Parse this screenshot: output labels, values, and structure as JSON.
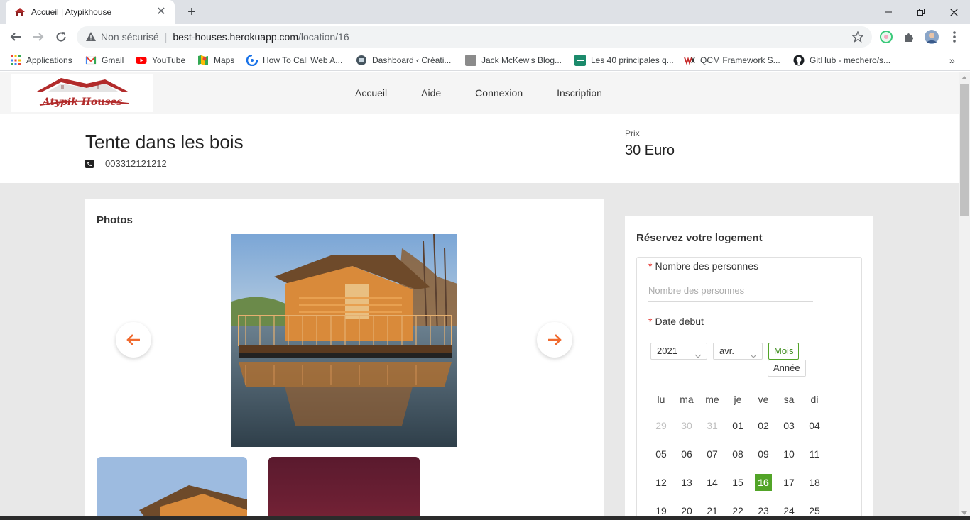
{
  "browser": {
    "tab_title": "Accueil | Atypikhouse",
    "new_tab": "+",
    "close_tab": "✕",
    "url_security": "Non sécurisé",
    "url_host": "best-houses.herokuapp.com",
    "url_path": "/location/16",
    "bookmarks": [
      {
        "label": "Applications",
        "icon": "apps-grid-icon"
      },
      {
        "label": "Gmail",
        "icon": "gmail-icon"
      },
      {
        "label": "YouTube",
        "icon": "youtube-icon"
      },
      {
        "label": "Maps",
        "icon": "maps-icon"
      },
      {
        "label": "How To Call Web A...",
        "icon": "web-api-icon"
      },
      {
        "label": "Dashboard ‹ Créati...",
        "icon": "dashboard-icon"
      },
      {
        "label": "Jack McKew's Blog...",
        "icon": "blog-icon"
      },
      {
        "label": "Les 40 principales q...",
        "icon": "list-icon"
      },
      {
        "label": "QCM Framework S...",
        "icon": "qcm-icon"
      },
      {
        "label": "GitHub - mechero/s...",
        "icon": "github-icon"
      }
    ],
    "more_bookmarks": "»"
  },
  "site": {
    "logo_text": "Atypik Houses",
    "nav": [
      "Accueil",
      "Aide",
      "Connexion",
      "Inscription"
    ]
  },
  "listing": {
    "title": "Tente dans les bois",
    "phone": "003312121212",
    "price_label": "Prix",
    "price_value": "30 Euro"
  },
  "photos": {
    "title": "Photos"
  },
  "booking": {
    "title": "Réservez votre logement",
    "required_mark": "*",
    "people_label": "Nombre des personnes",
    "people_placeholder": "Nombre des personnes",
    "date_label": "Date debut",
    "year": "2021",
    "month": "avr.",
    "mode_month": "Mois",
    "mode_year": "Année",
    "weekdays": [
      "lu",
      "ma",
      "me",
      "je",
      "ve",
      "sa",
      "di"
    ],
    "weeks": [
      [
        "29",
        "30",
        "31",
        "01",
        "02",
        "03",
        "04"
      ],
      [
        "05",
        "06",
        "07",
        "08",
        "09",
        "10",
        "11"
      ],
      [
        "12",
        "13",
        "14",
        "15",
        "16",
        "17",
        "18"
      ],
      [
        "19",
        "20",
        "21",
        "22",
        "23",
        "24",
        "25"
      ]
    ],
    "muted_days": [
      "29",
      "30",
      "31"
    ],
    "selected_day": "16",
    "accent_color": "#52a428"
  },
  "colors": {
    "arrow": "#f06a2f",
    "brand_red": "#b22b2b"
  }
}
